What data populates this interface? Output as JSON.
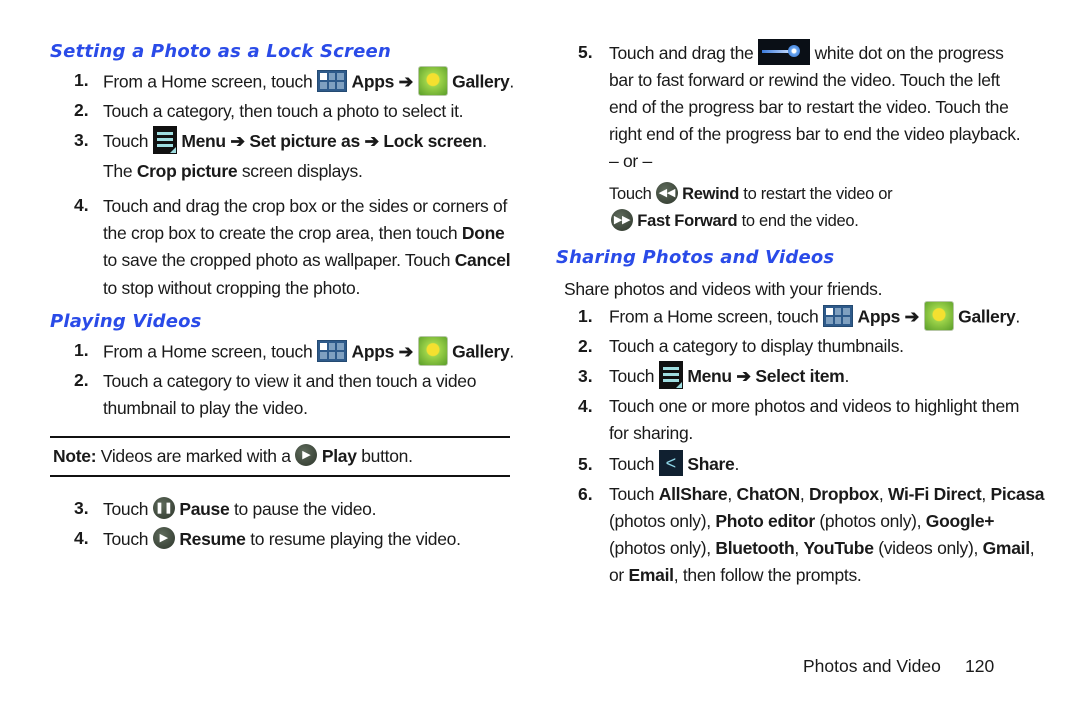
{
  "left": {
    "section1": {
      "heading": "Setting a Photo as a Lock Screen",
      "steps": [
        {
          "num": "1.",
          "pre": "From a Home screen, touch",
          "apps": "Apps",
          "arrow": "➔",
          "gallery": "Gallery",
          "end": "."
        },
        {
          "num": "2.",
          "text": "Touch a category, then touch a photo to select it."
        },
        {
          "num": "3.",
          "pre": "Touch",
          "menu": "Menu",
          "arrow1": "➔",
          "set": "Set picture as",
          "arrow2": "➔",
          "lock": "Lock screen",
          "end": ".",
          "line2_pre": "The",
          "crop": "Crop picture",
          "line2_post": "screen displays."
        },
        {
          "num": "4.",
          "lines": [
            "Touch and drag the crop box or the sides or corners of",
            "the crop box to create the crop area, then touch"
          ],
          "done": "Done",
          "line3_pre": "to save the cropped photo as wallpaper. Touch",
          "cancel": "Cancel",
          "line4": "to stop without cropping the photo."
        }
      ]
    },
    "section2": {
      "heading": "Playing Videos",
      "steps": [
        {
          "num": "1.",
          "pre": "From a Home screen, touch",
          "apps": "Apps",
          "arrow": "➔",
          "gallery": "Gallery",
          "end": "."
        },
        {
          "num": "2.",
          "lines": [
            "Touch a category to view it and then touch a video",
            "thumbnail to play the video."
          ]
        },
        {
          "num": "3.",
          "pre": "Touch",
          "label": "Pause",
          "post": "to pause the video."
        },
        {
          "num": "4.",
          "pre": "Touch",
          "label": "Resume",
          "post": "to resume playing the video."
        }
      ],
      "note": {
        "label": "Note:",
        "pre": "Videos are marked with a",
        "play": "Play",
        "post": "button."
      }
    }
  },
  "right": {
    "step5": {
      "num": "5.",
      "pre": "Touch and drag the",
      "post": "white dot on the progress",
      "lines": [
        "bar to fast forward or rewind the video. Touch the left",
        "end of the progress bar to restart the video. Touch the",
        "right end of the progress bar to end the video playback."
      ],
      "or": "– or –",
      "rewind_pre": "Touch",
      "rewind": "Rewind",
      "rewind_post": "to restart the video or",
      "ff": "Fast Forward",
      "ff_post": "to end the video."
    },
    "section3": {
      "heading": "Sharing Photos and Videos",
      "intro": "Share photos and videos with your friends.",
      "steps": [
        {
          "num": "1.",
          "pre": "From a Home screen, touch",
          "apps": "Apps",
          "arrow": "➔",
          "gallery": "Gallery",
          "end": "."
        },
        {
          "num": "2.",
          "text": "Touch a category to display thumbnails."
        },
        {
          "num": "3.",
          "pre": "Touch",
          "menu": "Menu",
          "arrow": "➔",
          "select": "Select item",
          "end": "."
        },
        {
          "num": "4.",
          "lines": [
            "Touch one or more photos and videos to highlight them",
            "for sharing."
          ]
        },
        {
          "num": "5.",
          "pre": "Touch",
          "share": "Share",
          "end": "."
        },
        {
          "num": "6.",
          "parts": {
            "touch": "Touch",
            "allshare": "AllShare",
            "chaton": "ChatON",
            "dropbox": "Dropbox",
            "wifi": "Wi-Fi Direct",
            "picasa": "Picasa",
            "photos_only1": "(photos only),",
            "photo_editor": "Photo editor",
            "photos_only2": "(photos only),",
            "google": "Google+",
            "photos_only3": "(photos only),",
            "bluetooth": "Bluetooth",
            "youtube": "YouTube",
            "videos_only": "(videos only),",
            "gmail": "Gmail",
            "or": "or",
            "email": "Email",
            "tail": ", then follow the prompts.",
            "comma": ","
          }
        }
      ]
    }
  },
  "footer": {
    "section": "Photos and Video",
    "page": "120"
  }
}
